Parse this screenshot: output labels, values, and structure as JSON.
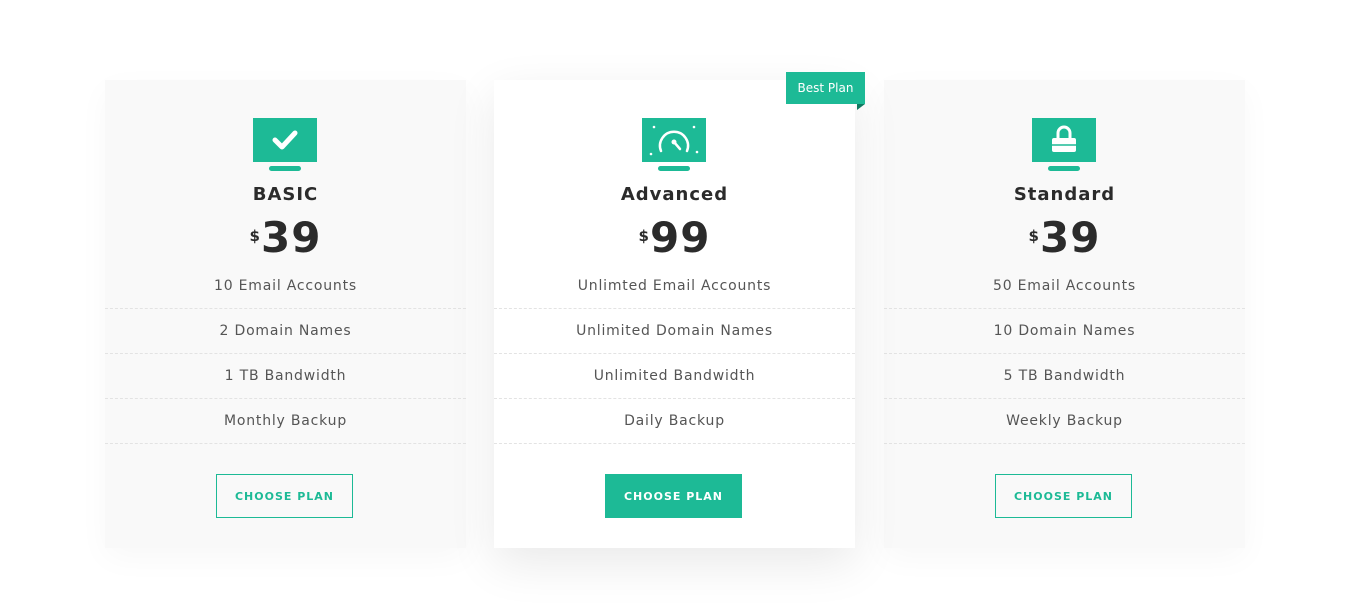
{
  "colors": {
    "accent": "#1dba96",
    "text_dark": "#2b2b2b",
    "text_muted": "#555555",
    "card_bg": "#f9f9f9",
    "featured_bg": "#ffffff"
  },
  "badge": {
    "label": "Best Plan"
  },
  "plans": [
    {
      "name": "BASIC",
      "icon": "monitor-check-icon",
      "currency": "$",
      "price": "39",
      "features": [
        "10 Email Accounts",
        "2 Domain Names",
        "1 TB Bandwidth",
        "Monthly Backup"
      ],
      "button_label": "CHOOSE PLAN"
    },
    {
      "name": "Advanced",
      "icon": "monitor-speedometer-icon",
      "currency": "$",
      "price": "99",
      "features": [
        "Unlimted Email Accounts",
        "Unlimited Domain Names",
        "Unlimited Bandwidth",
        "Daily Backup"
      ],
      "button_label": "CHOOSE PLAN"
    },
    {
      "name": "Standard",
      "icon": "monitor-lock-icon",
      "currency": "$",
      "price": "39",
      "features": [
        "50 Email Accounts",
        "10 Domain Names",
        "5 TB Bandwidth",
        "Weekly Backup"
      ],
      "button_label": "CHOOSE PLAN"
    }
  ]
}
